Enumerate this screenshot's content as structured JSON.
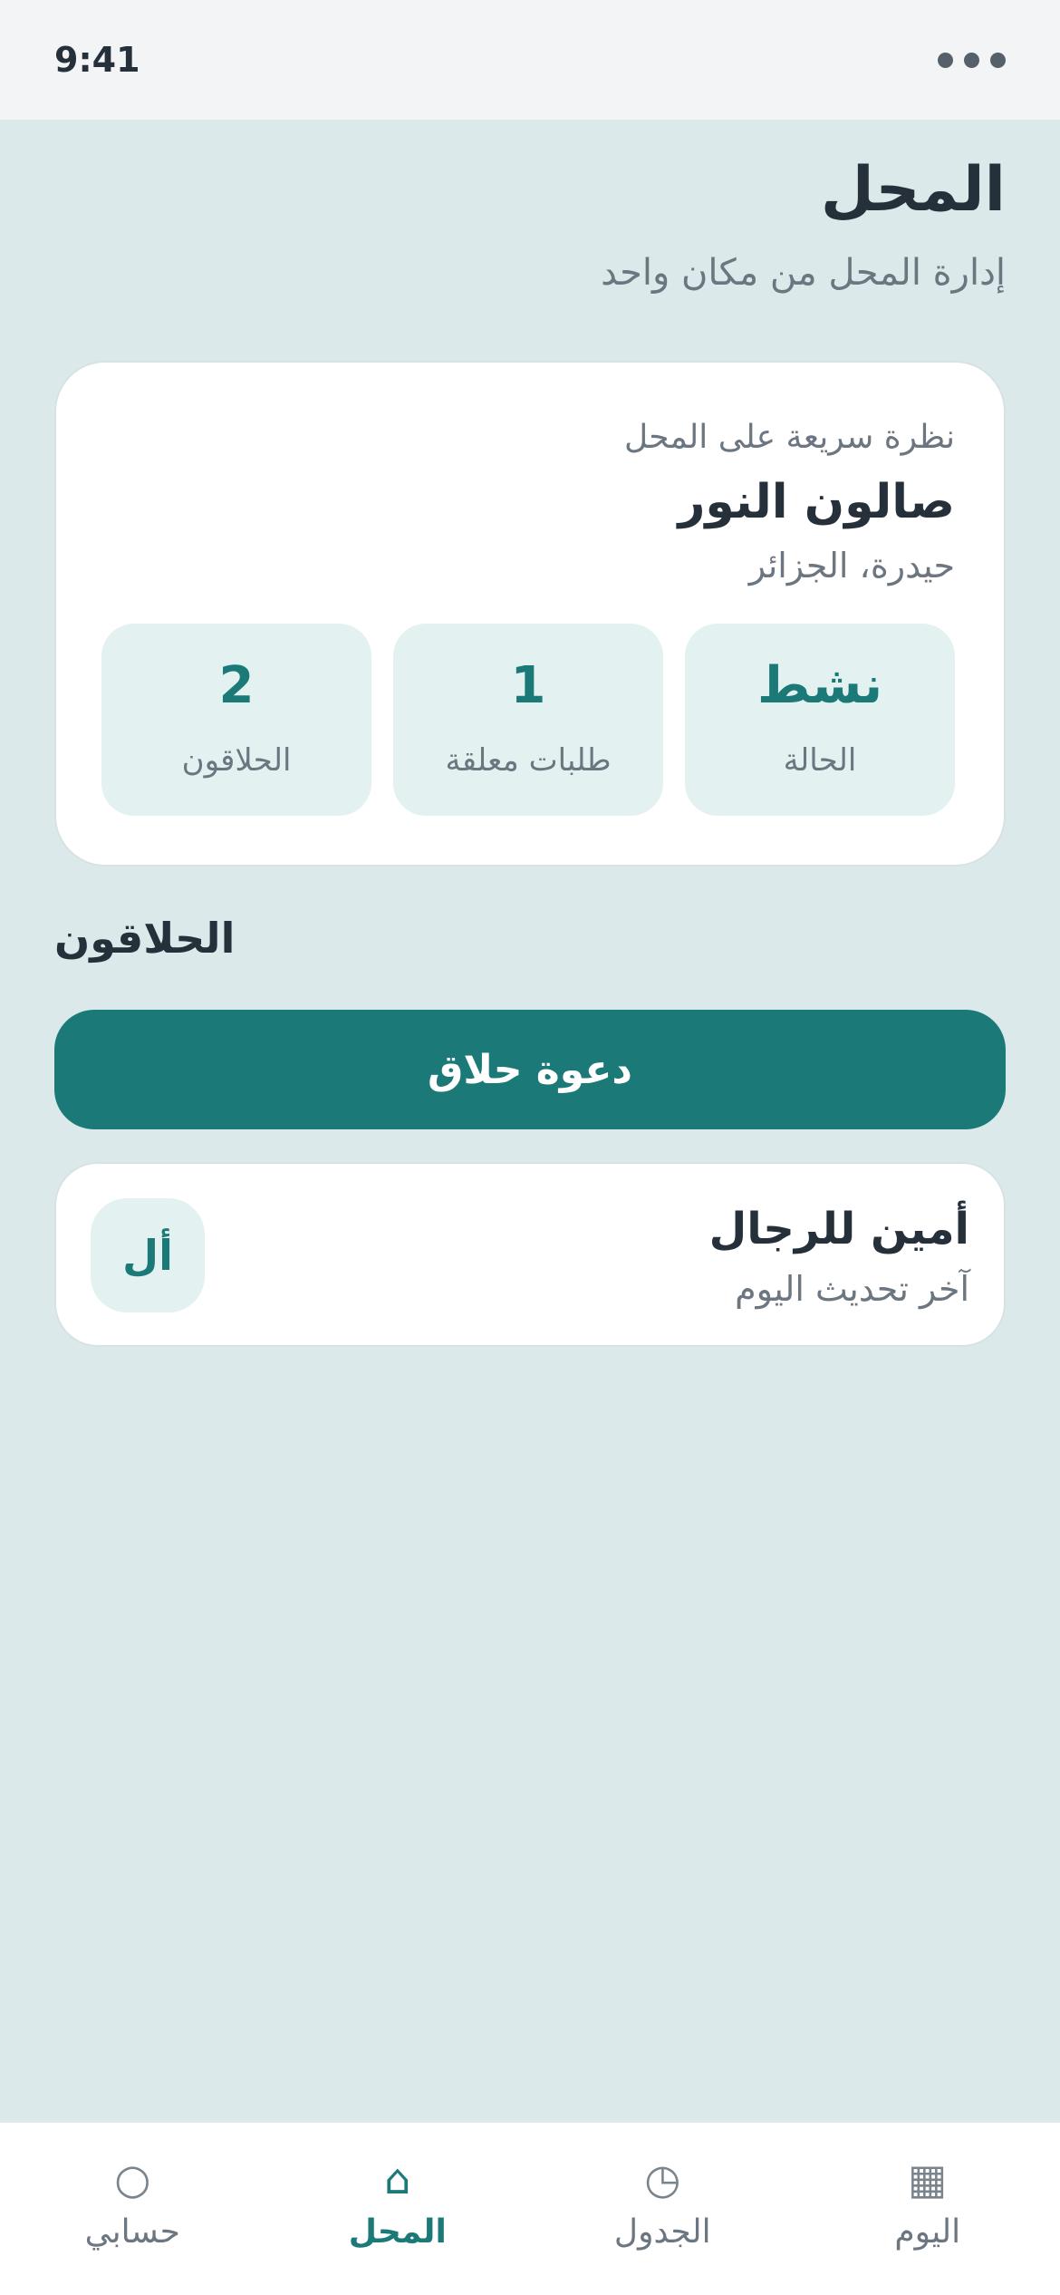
{
  "status_bar": {
    "time": "9:41"
  },
  "header": {
    "title": "المحل",
    "subtitle": "إدارة المحل من مكان واحد"
  },
  "overview": {
    "eyebrow": "نظرة سريعة على المحل",
    "shop_name": "صالون النور",
    "location": "حيدرة، الجزائر",
    "stats": [
      {
        "value": "نشط",
        "label": "الحالة"
      },
      {
        "value": "1",
        "label": "طلبات معلقة"
      },
      {
        "value": "2",
        "label": "الحلاقون"
      }
    ]
  },
  "barbers_section": {
    "title": "الحلاقون",
    "invite_label": "دعوة حلاق",
    "items": [
      {
        "name": "أمين للرجال",
        "updated": "آخر تحديث اليوم",
        "initials": "أل"
      }
    ]
  },
  "bottom_nav": {
    "active": "shop",
    "items": [
      {
        "id": "today",
        "label": "اليوم",
        "icon": "calendar-grid-icon"
      },
      {
        "id": "schedule",
        "label": "الجدول",
        "icon": "clock-icon"
      },
      {
        "id": "shop",
        "label": "المحل",
        "icon": "home-icon"
      },
      {
        "id": "account",
        "label": "حسابي",
        "icon": "user-circle-icon"
      }
    ]
  },
  "colors": {
    "accent": "#1b7a78",
    "background": "#dce9ea",
    "tile": "#e3f1f1"
  }
}
